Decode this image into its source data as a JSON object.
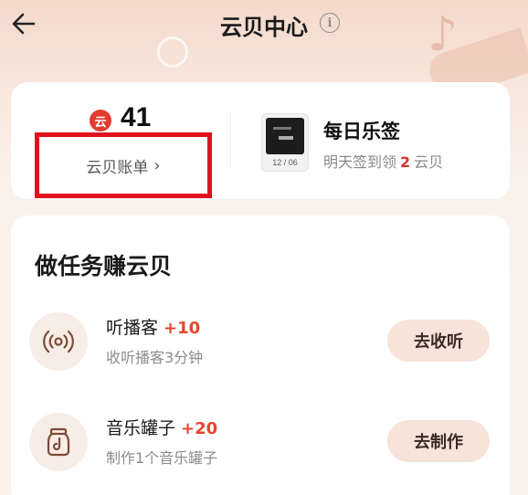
{
  "header": {
    "title": "云贝中心",
    "info_glyph": "i",
    "back_icon": "back-arrow-icon"
  },
  "balance": {
    "coin_glyph": "云",
    "count": "41",
    "ledger_label": "云贝账单",
    "ledger_chevron": "›"
  },
  "checkin": {
    "thumb_date": "12 / 06",
    "title": "每日乐签",
    "sub_prefix": "明天签到领",
    "sub_amount": "2",
    "sub_suffix": "云贝"
  },
  "tasks": {
    "title": "做任务赚云贝",
    "items": [
      {
        "name": "听播客",
        "reward": "+10",
        "desc": "收听播客3分钟",
        "button": "去收听",
        "icon": "podcast-broadcast-icon"
      },
      {
        "name": "音乐罐子",
        "reward": "+20",
        "desc": "制作1个音乐罐子",
        "button": "去制作",
        "icon": "music-jar-icon"
      }
    ]
  },
  "colors": {
    "accent_red": "#e6452f",
    "highlight_border": "#e0121e",
    "button_bg": "#f6e3d9"
  }
}
